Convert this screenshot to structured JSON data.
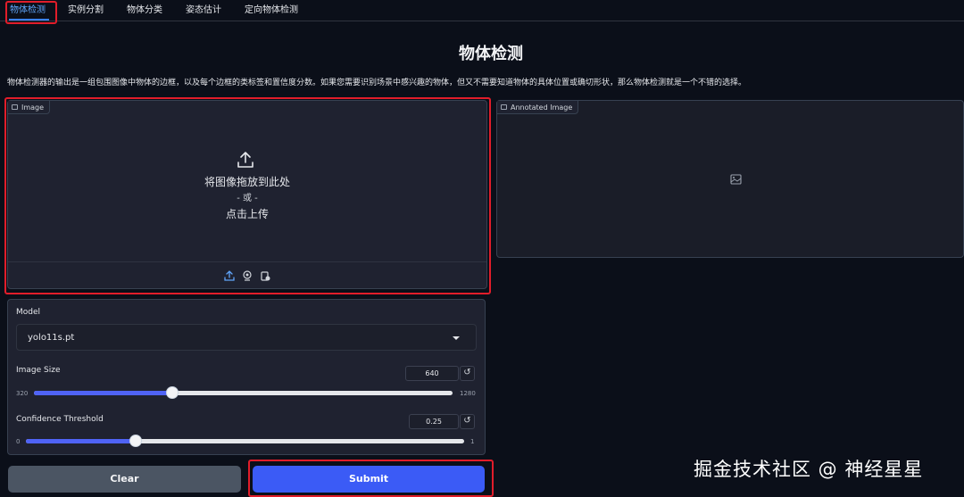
{
  "tabs": [
    "物体检测",
    "实例分割",
    "物体分类",
    "姿态估计",
    "定向物体检测"
  ],
  "page": {
    "title": "物体检测",
    "description": "物体检测器的输出是一组包围图像中物体的边框，以及每个边框的类标签和置信度分数。如果您需要识别场景中感兴趣的物体，但又不需要知道物体的具体位置或确切形状，那么物体检测就是一个不错的选择。"
  },
  "image_panel": {
    "label": "Image",
    "drop_text": "将图像拖放到此处",
    "or_text": "- 或 -",
    "upload_text": "点击上传",
    "sources": [
      "upload-icon",
      "webcam-icon",
      "clipboard-icon"
    ]
  },
  "annotated_panel": {
    "label": "Annotated Image"
  },
  "controls": {
    "model": {
      "label": "Model",
      "value": "yolo11s.pt"
    },
    "image_size": {
      "label": "Image Size",
      "value": "640",
      "min": "320",
      "max": "1280",
      "fraction": 0.33
    },
    "confidence": {
      "label": "Confidence Threshold",
      "value": "0.25",
      "min": "0",
      "max": "1",
      "fraction": 0.25
    }
  },
  "buttons": {
    "clear": "Clear",
    "submit": "Submit"
  },
  "watermark": "掘金技术社区 @ 神经星星",
  "colors": {
    "accent": "#3b5bf6",
    "highlight": "#e11d2a",
    "background": "#0b0f19"
  }
}
